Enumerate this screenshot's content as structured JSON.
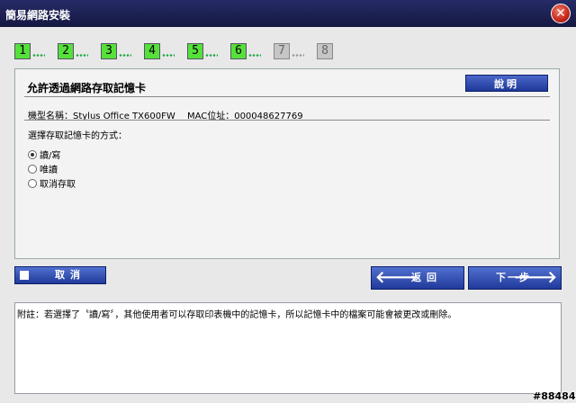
{
  "window": {
    "title": "簡易網路安裝",
    "close_glyph": "✕"
  },
  "steps": [
    {
      "label": "1",
      "state": "done"
    },
    {
      "label": "2",
      "state": "done"
    },
    {
      "label": "3",
      "state": "done"
    },
    {
      "label": "4",
      "state": "done"
    },
    {
      "label": "5",
      "state": "done"
    },
    {
      "label": "6",
      "state": "done"
    },
    {
      "label": "7",
      "state": "todo"
    },
    {
      "label": "8",
      "state": "todo"
    }
  ],
  "panel": {
    "title": "允許透過網路存取記憶卡",
    "help_label": "說明",
    "model": "機型名稱：Stylus Office TX600FW",
    "mac": "MAC位址：000048627769",
    "question": "選擇存取記憶卡的方式：",
    "options": [
      {
        "label": "讀/寫",
        "checked": true
      },
      {
        "label": "唯讀",
        "checked": false
      },
      {
        "label": "取消存取",
        "checked": false
      }
    ]
  },
  "buttons": {
    "cancel": "取消",
    "back": "返回",
    "next": "下一步",
    "back_arrow": "🡐",
    "next_arrow": "🡒"
  },
  "note": "附註：若選擇了〝讀/寫〞，其他使用者可以存取印表機中的記憶卡，所以記憶卡中的檔案可能會被更改或刪除。",
  "watermark": "#88484",
  "colors": {
    "title_bar": "#1d2155",
    "step_done": "#56e03a",
    "step_todo": "#c6c6c6",
    "button_blue": "#203a9a",
    "close_red": "#c4261a"
  }
}
